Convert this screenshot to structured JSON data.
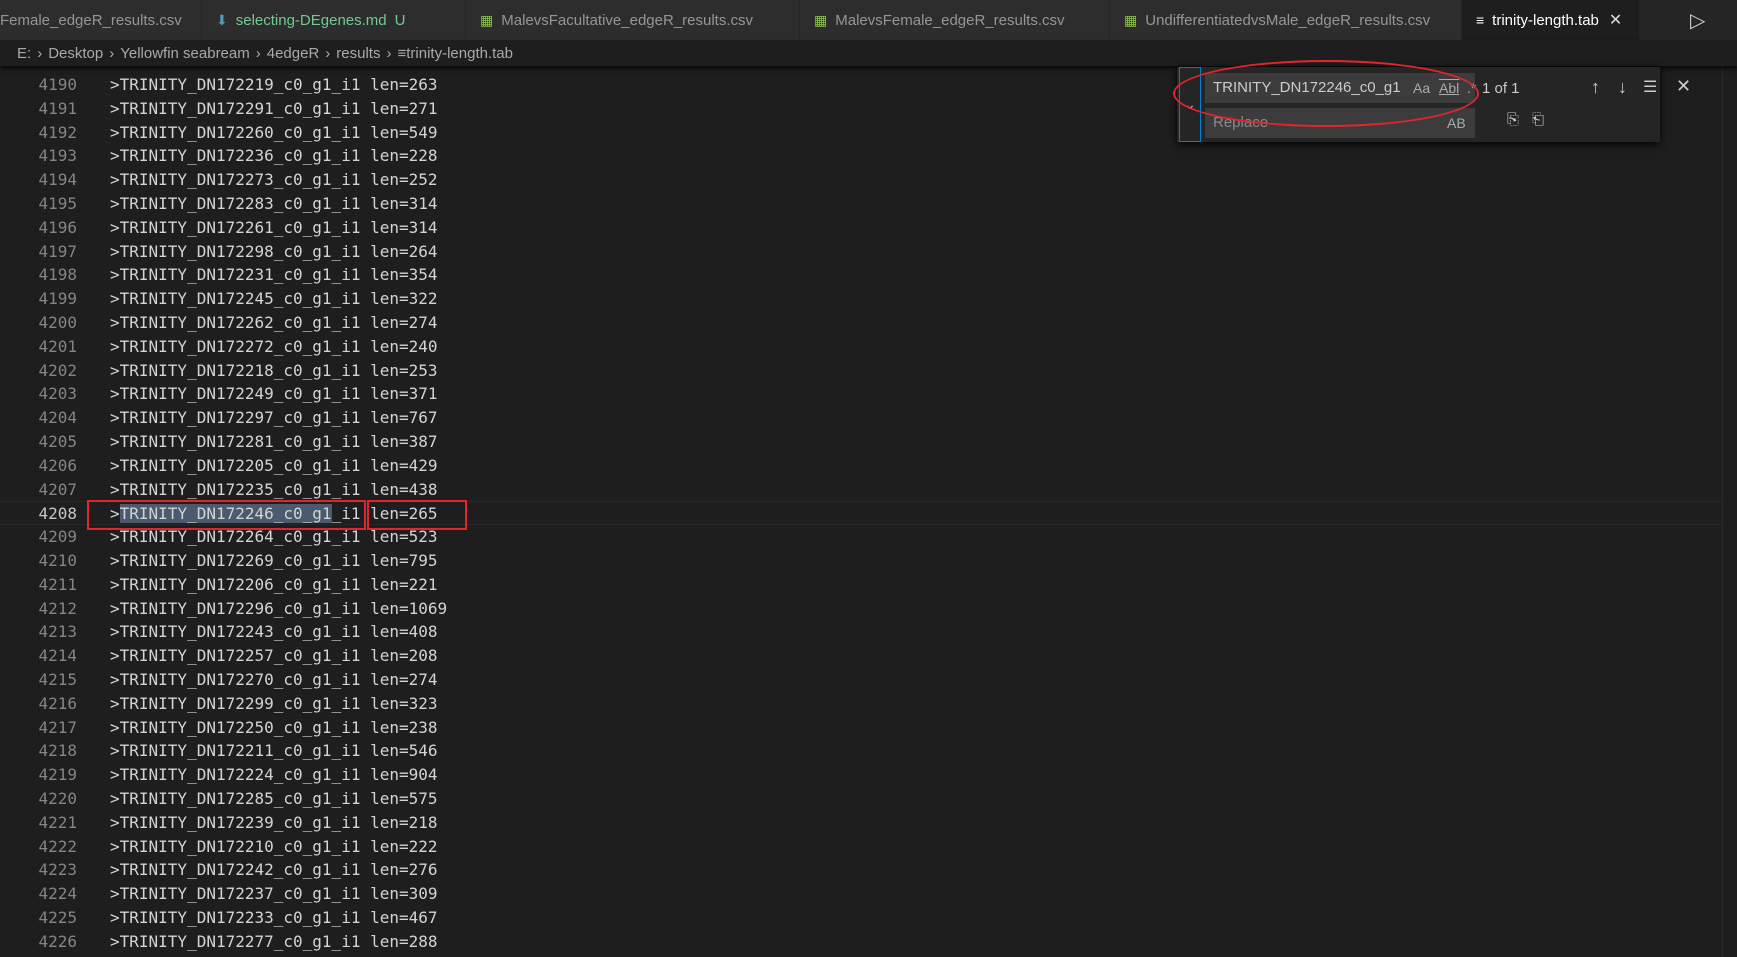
{
  "tabs": [
    {
      "label": "Female_edgeR_results.csv",
      "icon": "csv-icon",
      "type": "csv"
    },
    {
      "label": "selecting-DEgenes.md",
      "status": "U",
      "icon": "markdown-icon",
      "type": "md"
    },
    {
      "label": "MalevsFacultative_edgeR_results.csv",
      "icon": "csv-icon",
      "type": "csv"
    },
    {
      "label": "MalevsFemale_edgeR_results.csv",
      "icon": "csv-icon",
      "type": "csv"
    },
    {
      "label": "UndifferentiatedvsMale_edgeR_results.csv",
      "icon": "csv-icon",
      "type": "csv"
    },
    {
      "label": "trinity-length.tab",
      "icon": "text-file-icon",
      "active": true
    }
  ],
  "breadcrumb": [
    "E:",
    "Desktop",
    "Yellowfin seabream",
    "4edgeR",
    "results",
    "trinity-length.tab"
  ],
  "find": {
    "value": "TRINITY_DN172246_c0_g1",
    "replace_placeholder": "Replace",
    "match_case": "Aa",
    "whole_word": "Abl",
    "regex": ".*",
    "preserve_case": "AB",
    "count": "1 of 1"
  },
  "current_line": 4208,
  "selection": "TRINITY_DN172246_c0_g1",
  "lines": [
    {
      "n": "4190",
      "t": ">TRINITY_DN172219_c0_g1_i1 len=263"
    },
    {
      "n": "4191",
      "t": ">TRINITY_DN172291_c0_g1_i1 len=271"
    },
    {
      "n": "4192",
      "t": ">TRINITY_DN172260_c0_g1_i1 len=549"
    },
    {
      "n": "4193",
      "t": ">TRINITY_DN172236_c0_g1_i1 len=228"
    },
    {
      "n": "4194",
      "t": ">TRINITY_DN172273_c0_g1_i1 len=252"
    },
    {
      "n": "4195",
      "t": ">TRINITY_DN172283_c0_g1_i1 len=314"
    },
    {
      "n": "4196",
      "t": ">TRINITY_DN172261_c0_g1_i1 len=314"
    },
    {
      "n": "4197",
      "t": ">TRINITY_DN172298_c0_g1_i1 len=264"
    },
    {
      "n": "4198",
      "t": ">TRINITY_DN172231_c0_g1_i1 len=354"
    },
    {
      "n": "4199",
      "t": ">TRINITY_DN172245_c0_g1_i1 len=322"
    },
    {
      "n": "4200",
      "t": ">TRINITY_DN172262_c0_g1_i1 len=274"
    },
    {
      "n": "4201",
      "t": ">TRINITY_DN172272_c0_g1_i1 len=240"
    },
    {
      "n": "4202",
      "t": ">TRINITY_DN172218_c0_g1_i1 len=253"
    },
    {
      "n": "4203",
      "t": ">TRINITY_DN172249_c0_g1_i1 len=371"
    },
    {
      "n": "4204",
      "t": ">TRINITY_DN172297_c0_g1_i1 len=767"
    },
    {
      "n": "4205",
      "t": ">TRINITY_DN172281_c0_g1_i1 len=387"
    },
    {
      "n": "4206",
      "t": ">TRINITY_DN172205_c0_g1_i1 len=429"
    },
    {
      "n": "4207",
      "t": ">TRINITY_DN172235_c0_g1_i1 len=438"
    },
    {
      "n": "4208",
      "t": ">TRINITY_DN172246_c0_g1_i1 len=265"
    },
    {
      "n": "4209",
      "t": ">TRINITY_DN172264_c0_g1_i1 len=523"
    },
    {
      "n": "4210",
      "t": ">TRINITY_DN172269_c0_g1_i1 len=795"
    },
    {
      "n": "4211",
      "t": ">TRINITY_DN172206_c0_g1_i1 len=221"
    },
    {
      "n": "4212",
      "t": ">TRINITY_DN172296_c0_g1_i1 len=1069"
    },
    {
      "n": "4213",
      "t": ">TRINITY_DN172243_c0_g1_i1 len=408"
    },
    {
      "n": "4214",
      "t": ">TRINITY_DN172257_c0_g1_i1 len=208"
    },
    {
      "n": "4215",
      "t": ">TRINITY_DN172270_c0_g1_i1 len=274"
    },
    {
      "n": "4216",
      "t": ">TRINITY_DN172299_c0_g1_i1 len=323"
    },
    {
      "n": "4217",
      "t": ">TRINITY_DN172250_c0_g1_i1 len=238"
    },
    {
      "n": "4218",
      "t": ">TRINITY_DN172211_c0_g1_i1 len=546"
    },
    {
      "n": "4219",
      "t": ">TRINITY_DN172224_c0_g1_i1 len=904"
    },
    {
      "n": "4220",
      "t": ">TRINITY_DN172285_c0_g1_i1 len=575"
    },
    {
      "n": "4221",
      "t": ">TRINITY_DN172239_c0_g1_i1 len=218"
    },
    {
      "n": "4222",
      "t": ">TRINITY_DN172210_c0_g1_i1 len=222"
    },
    {
      "n": "4223",
      "t": ">TRINITY_DN172242_c0_g1_i1 len=276"
    },
    {
      "n": "4224",
      "t": ">TRINITY_DN172237_c0_g1_i1 len=309"
    },
    {
      "n": "4225",
      "t": ">TRINITY_DN172233_c0_g1_i1 len=467"
    },
    {
      "n": "4226",
      "t": ">TRINITY_DN172277_c0_g1_i1 len=288"
    }
  ],
  "colors": {
    "annotation": "#e0262b",
    "background": "#1e1e1e"
  }
}
